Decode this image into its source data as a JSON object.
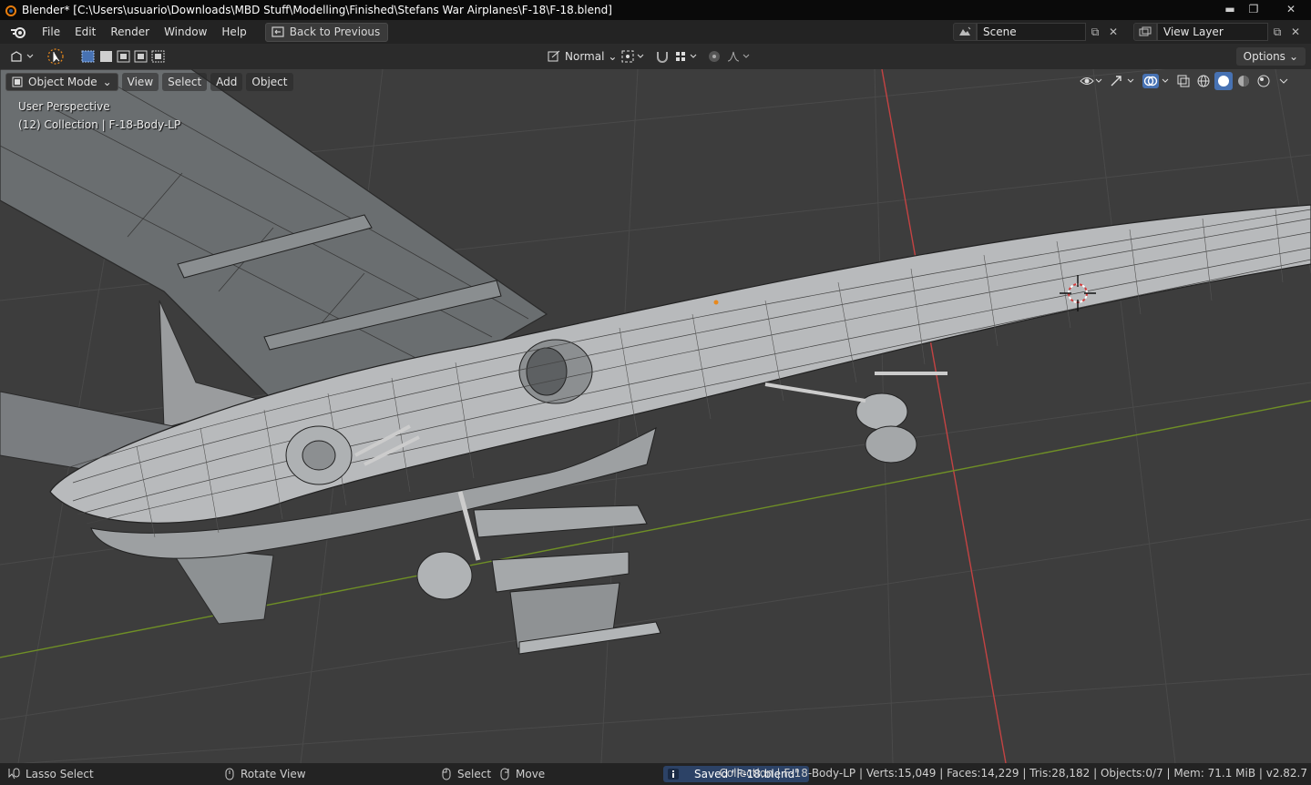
{
  "window": {
    "title": "Blender* [C:\\Users\\usuario\\Downloads\\MBD Stuff\\Modelling\\Finished\\Stefans War Airplanes\\F-18\\F-18.blend]"
  },
  "topbar": {
    "menus": [
      "File",
      "Edit",
      "Render",
      "Window",
      "Help"
    ],
    "back_label": "Back to Previous",
    "scene_label": "Scene",
    "view_layer_label": "View Layer"
  },
  "toolbar": {
    "transform_orientation": "Normal",
    "options_label": "Options"
  },
  "viewport": {
    "mode": "Object Mode",
    "menus": [
      "View",
      "Select",
      "Add",
      "Object"
    ],
    "perspective_text": "User Perspective",
    "collection_text": "(12) Collection | F-18-Body-LP"
  },
  "statusbar": {
    "lasso": "Lasso Select",
    "rotate": "Rotate View",
    "select": "Select",
    "move": "Move",
    "saved": "Saved \"F-18.blend\"",
    "stats": "Collection | F-18-Body-LP | Verts:15,049 | Faces:14,229 | Tris:28,182 | Objects:0/7 | Mem: 71.1 MiB | v2.82.7"
  },
  "colors": {
    "viewport_bg": "#3d3d3d",
    "x_axis": "#d04848",
    "y_axis": "#7a9a2a",
    "active_accent": "#4772b3"
  },
  "icons": [
    "blender-logo-icon",
    "window-minimize-icon",
    "window-maximize-icon",
    "window-close-icon",
    "editor-type-icon",
    "select-tool-icon",
    "box-select-mode-icon",
    "transform-orientation-icon",
    "pivot-icon",
    "snap-icon",
    "proportional-edit-icon",
    "visibility-icon",
    "gizmo-icon",
    "overlay-icon",
    "xray-icon",
    "wireframe-shading-icon",
    "solid-shading-icon",
    "material-shading-icon",
    "rendered-shading-icon",
    "3d-cursor-icon",
    "mouse-left-icon",
    "mouse-middle-icon",
    "info-icon"
  ]
}
